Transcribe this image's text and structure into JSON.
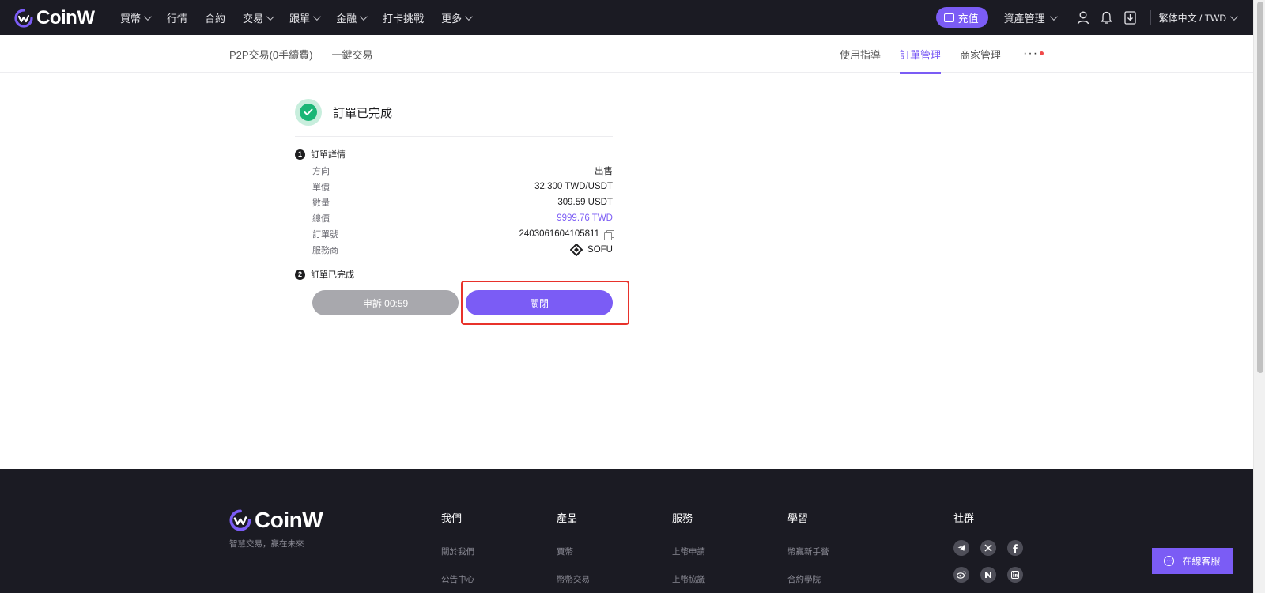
{
  "brand": {
    "name": "CoinW",
    "accent": "#7b5cf5"
  },
  "topnav": {
    "items": [
      {
        "label": "買幣",
        "dropdown": true
      },
      {
        "label": "行情",
        "dropdown": false
      },
      {
        "label": "合約",
        "dropdown": false
      },
      {
        "label": "交易",
        "dropdown": true
      },
      {
        "label": "跟單",
        "dropdown": true
      },
      {
        "label": "金融",
        "dropdown": true
      },
      {
        "label": "打卡挑戰",
        "dropdown": false
      },
      {
        "label": "更多",
        "dropdown": true
      }
    ],
    "deposit_label": "充值",
    "asset_label": "資產管理",
    "language": "繁体中文 / TWD"
  },
  "subnav": {
    "left": [
      "P2P交易(0手續費)",
      "一鍵交易"
    ],
    "right": [
      {
        "label": "使用指導",
        "active": false
      },
      {
        "label": "訂單管理",
        "active": true
      },
      {
        "label": "商家管理",
        "active": false
      }
    ],
    "more": "···"
  },
  "order": {
    "status_title": "訂單已完成",
    "section1": {
      "num": "1",
      "title": "訂單詳情"
    },
    "details": [
      {
        "label": "方向",
        "value": "出售"
      },
      {
        "label": "單價",
        "value": "32.300 TWD/USDT"
      },
      {
        "label": "數量",
        "value": "309.59 USDT"
      },
      {
        "label": "總價",
        "value": "9999.76 TWD"
      },
      {
        "label": "訂單號",
        "value": "2403061604105811"
      },
      {
        "label": "服務商",
        "value": "SOFU"
      }
    ],
    "section2": {
      "num": "2",
      "title": "訂單已完成"
    },
    "appeal_label": "申訴 00:59",
    "close_label": "關閉"
  },
  "footer": {
    "slogan": "智慧交易，贏在未來",
    "columns": [
      {
        "title": "我們",
        "links": [
          "關於我們",
          "公告中心"
        ]
      },
      {
        "title": "產品",
        "links": [
          "買幣",
          "幣幣交易"
        ]
      },
      {
        "title": "服務",
        "links": [
          "上幣申請",
          "上幣協議"
        ]
      },
      {
        "title": "學習",
        "links": [
          "幣贏新手營",
          "合約學院"
        ]
      }
    ],
    "social_title": "社群",
    "social_icons": [
      "telegram-icon",
      "x-icon",
      "facebook-icon",
      "weibo-icon",
      "naver-icon",
      "linkedin-icon"
    ]
  },
  "chat": {
    "label": "在線客服"
  }
}
